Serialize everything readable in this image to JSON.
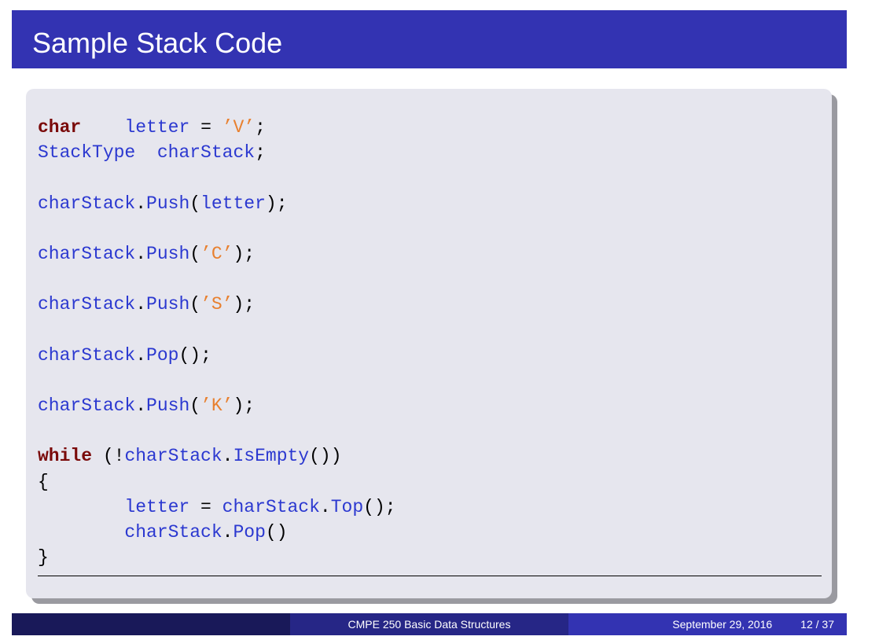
{
  "slide": {
    "title": "Sample Stack Code"
  },
  "code_lines": [
    [
      {
        "t": "char",
        "c": "kw"
      },
      {
        "t": "    ",
        "c": "pun"
      },
      {
        "t": "letter",
        "c": "id"
      },
      {
        "t": " = ",
        "c": "pun"
      },
      {
        "t": "’V’",
        "c": "str"
      },
      {
        "t": ";",
        "c": "pun"
      }
    ],
    [
      {
        "t": "StackType",
        "c": "id"
      },
      {
        "t": "  ",
        "c": "pun"
      },
      {
        "t": "charStack",
        "c": "id"
      },
      {
        "t": ";",
        "c": "pun"
      }
    ],
    [],
    [
      {
        "t": "charStack",
        "c": "id"
      },
      {
        "t": ".",
        "c": "pun"
      },
      {
        "t": "Push",
        "c": "id"
      },
      {
        "t": "(",
        "c": "pun"
      },
      {
        "t": "letter",
        "c": "id"
      },
      {
        "t": ");",
        "c": "pun"
      }
    ],
    [],
    [
      {
        "t": "charStack",
        "c": "id"
      },
      {
        "t": ".",
        "c": "pun"
      },
      {
        "t": "Push",
        "c": "id"
      },
      {
        "t": "(",
        "c": "pun"
      },
      {
        "t": "’C’",
        "c": "str"
      },
      {
        "t": ");",
        "c": "pun"
      }
    ],
    [],
    [
      {
        "t": "charStack",
        "c": "id"
      },
      {
        "t": ".",
        "c": "pun"
      },
      {
        "t": "Push",
        "c": "id"
      },
      {
        "t": "(",
        "c": "pun"
      },
      {
        "t": "’S’",
        "c": "str"
      },
      {
        "t": ");",
        "c": "pun"
      }
    ],
    [],
    [
      {
        "t": "charStack",
        "c": "id"
      },
      {
        "t": ".",
        "c": "pun"
      },
      {
        "t": "Pop",
        "c": "id"
      },
      {
        "t": "();",
        "c": "pun"
      }
    ],
    [],
    [
      {
        "t": "charStack",
        "c": "id"
      },
      {
        "t": ".",
        "c": "pun"
      },
      {
        "t": "Push",
        "c": "id"
      },
      {
        "t": "(",
        "c": "pun"
      },
      {
        "t": "’K’",
        "c": "str"
      },
      {
        "t": ");",
        "c": "pun"
      }
    ],
    [],
    [
      {
        "t": "while",
        "c": "kw"
      },
      {
        "t": " (!",
        "c": "pun"
      },
      {
        "t": "charStack",
        "c": "id"
      },
      {
        "t": ".",
        "c": "pun"
      },
      {
        "t": "IsEmpty",
        "c": "id"
      },
      {
        "t": "())",
        "c": "pun"
      }
    ],
    [
      {
        "t": "{",
        "c": "pun"
      }
    ],
    [
      {
        "t": "        ",
        "c": "pun"
      },
      {
        "t": "letter",
        "c": "id"
      },
      {
        "t": " = ",
        "c": "pun"
      },
      {
        "t": "charStack",
        "c": "id"
      },
      {
        "t": ".",
        "c": "pun"
      },
      {
        "t": "Top",
        "c": "id"
      },
      {
        "t": "();",
        "c": "pun"
      }
    ],
    [
      {
        "t": "        ",
        "c": "pun"
      },
      {
        "t": "charStack",
        "c": "id"
      },
      {
        "t": ".",
        "c": "pun"
      },
      {
        "t": "Pop",
        "c": "id"
      },
      {
        "t": "()",
        "c": "pun"
      }
    ],
    [
      {
        "t": "}",
        "c": "pun"
      }
    ]
  ],
  "footer": {
    "course": "CMPE 250 Basic Data Structures",
    "date": "September 29, 2016",
    "page": "12 / 37"
  },
  "colors": {
    "title_bar": "#3333b2",
    "keyword": "#7a0a0a",
    "identifier": "#2b38d0",
    "string_literal": "#e8802f",
    "code_background": "#e6e6ee"
  }
}
